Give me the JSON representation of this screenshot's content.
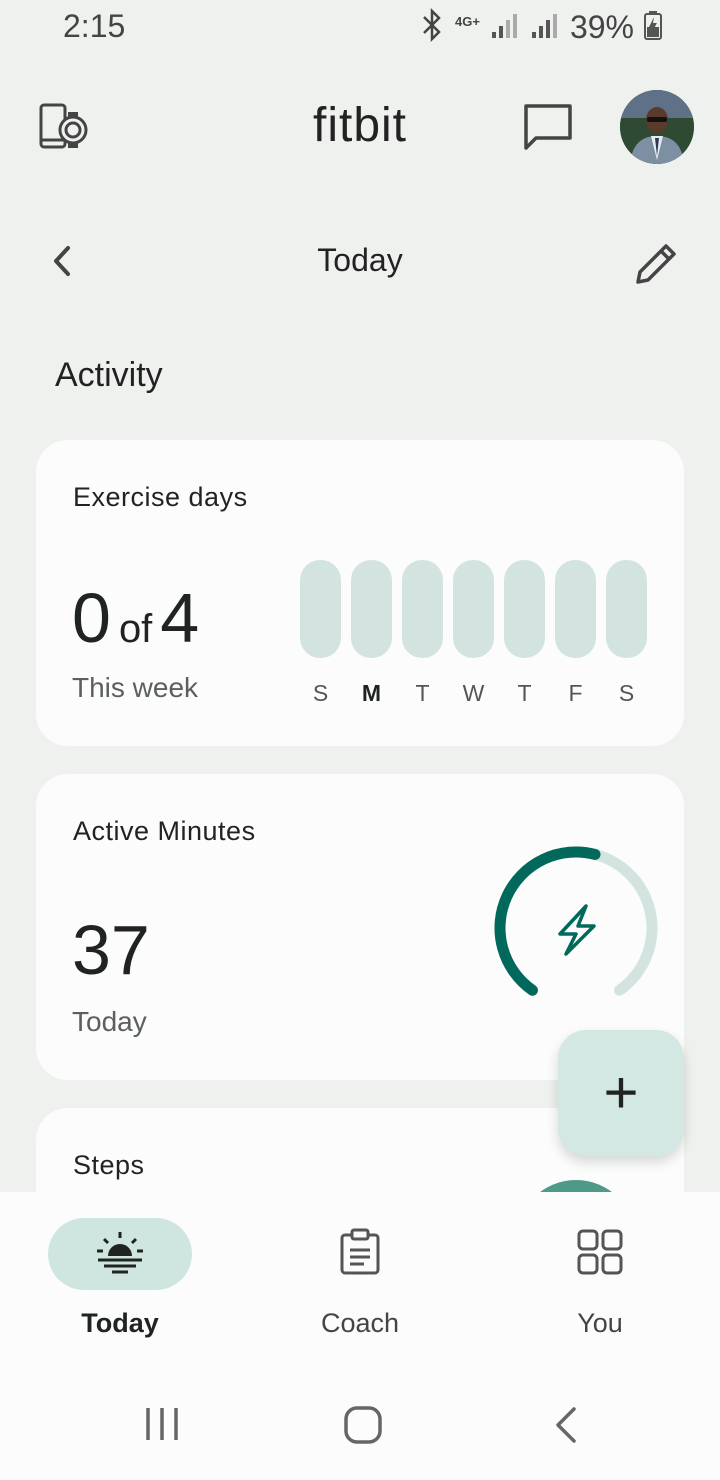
{
  "status_bar": {
    "time": "2:15",
    "network": "4G+",
    "battery": "39%"
  },
  "header": {
    "title": "fitbit"
  },
  "date_nav": {
    "label": "Today"
  },
  "section": {
    "title": "Activity"
  },
  "exercise_card": {
    "title": "Exercise days",
    "value": "0",
    "of_text": "of",
    "goal": "4",
    "subtitle": "This week",
    "days": [
      {
        "letter": "S",
        "current": false
      },
      {
        "letter": "M",
        "current": true
      },
      {
        "letter": "T",
        "current": false
      },
      {
        "letter": "W",
        "current": false
      },
      {
        "letter": "T",
        "current": false
      },
      {
        "letter": "F",
        "current": false
      },
      {
        "letter": "S",
        "current": false
      }
    ]
  },
  "active_minutes_card": {
    "title": "Active Minutes",
    "value": "37",
    "subtitle": "Today",
    "progress_fraction": 0.55
  },
  "steps_card": {
    "title": "Steps"
  },
  "fab": {
    "label": "+"
  },
  "bottom_nav": {
    "items": [
      {
        "label": "Today",
        "icon": "sunrise-icon",
        "active": true
      },
      {
        "label": "Coach",
        "icon": "clipboard-icon",
        "active": false
      },
      {
        "label": "You",
        "icon": "grid-icon",
        "active": false
      }
    ]
  },
  "colors": {
    "accent": "#00695c",
    "accent_light": "#d3e4e0",
    "background": "#eff1ef",
    "card": "#fbfcfb"
  }
}
